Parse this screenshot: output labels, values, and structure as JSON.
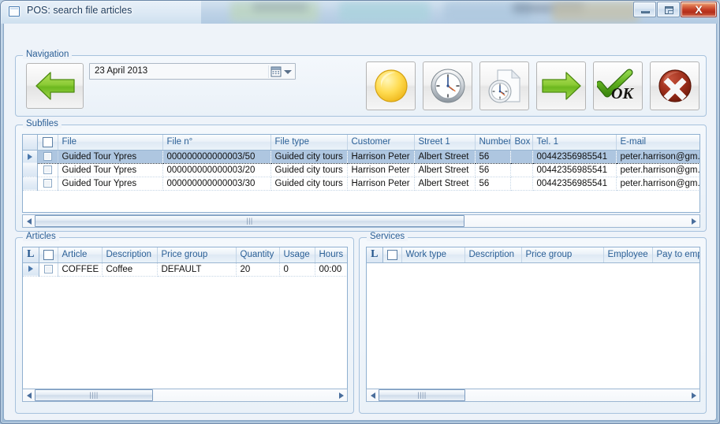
{
  "window": {
    "title": "POS: search file articles",
    "icon": "window-icon",
    "buttons": {
      "minimize": "Minimize",
      "maximize": "Maximize",
      "close": "X"
    }
  },
  "navigation": {
    "legend": "Navigation",
    "back_button": "back-arrow",
    "date_value": "23 April 2013",
    "date_placeholder": "dd MMMM yyyy",
    "dropdown_icon": "calendar-icon",
    "toolbar": [
      {
        "name": "yellow-coin-button",
        "label": ""
      },
      {
        "name": "clock-button",
        "label": ""
      },
      {
        "name": "clock-document-button",
        "label": ""
      },
      {
        "name": "green-forward-arrow-button",
        "label": ""
      },
      {
        "name": "ok-checkmark-button",
        "label": "OK"
      },
      {
        "name": "cancel-red-x-button",
        "label": ""
      }
    ]
  },
  "subfiles": {
    "legend": "Subfiles",
    "columns": [
      "",
      "",
      "File",
      "File n°",
      "File type",
      "Customer",
      "Street 1",
      "Number",
      "Box",
      "Tel. 1",
      "E-mail"
    ],
    "rows": [
      {
        "selected": true,
        "file": "Guided Tour Ypres",
        "file_no": "000000000000003/50",
        "file_type": "Guided city tours",
        "customer": "Harrison Peter",
        "street1": "Albert Street",
        "number": "56",
        "box": "",
        "tel1": "00442356985541",
        "email": "peter.harrison@gm..."
      },
      {
        "selected": false,
        "file": "Guided Tour Ypres",
        "file_no": "000000000000003/20",
        "file_type": "Guided city tours",
        "customer": "Harrison Peter",
        "street1": "Albert Street",
        "number": "56",
        "box": "",
        "tel1": "00442356985541",
        "email": "peter.harrison@gm..."
      },
      {
        "selected": false,
        "file": "Guided Tour Ypres",
        "file_no": "000000000000003/30",
        "file_type": "Guided city tours",
        "customer": "Harrison Peter",
        "street1": "Albert Street",
        "number": "56",
        "box": "",
        "tel1": "00442356985541",
        "email": "peter.harrison@gm..."
      }
    ]
  },
  "articles": {
    "legend": "Articles",
    "lcolumn_label": "L",
    "columns": [
      "L",
      "",
      "Article",
      "Description",
      "Price group",
      "Quantity",
      "Usage",
      "Hours"
    ],
    "rows": [
      {
        "selected": false,
        "article": "COFFEE",
        "description": "Coffee",
        "price_group": "DEFAULT",
        "quantity": "20",
        "usage": "0",
        "hours": "00:00"
      }
    ]
  },
  "services": {
    "legend": "Services",
    "lcolumn_label": "L",
    "columns": [
      "L",
      "",
      "Work type",
      "Description",
      "Price group",
      "Employee",
      "Pay to employ"
    ],
    "rows": []
  },
  "colors": {
    "accent": "#2a5f96",
    "selection": "#aec6e0",
    "border": "#8fb0d0",
    "panel_bg": "#eef3f9",
    "green": "#7ac943",
    "red": "#b22f1b",
    "yellow": "#ffd84d"
  }
}
